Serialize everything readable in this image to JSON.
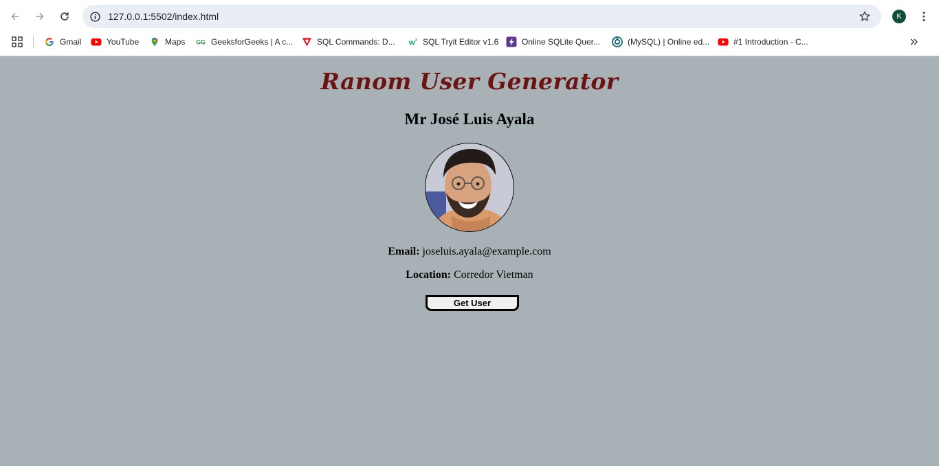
{
  "browser": {
    "url": "127.0.0.1:5502/index.html",
    "profile_initial": "K",
    "bookmarks": [
      {
        "label": "Gmail",
        "icon": "google-icon"
      },
      {
        "label": "YouTube",
        "icon": "youtube-icon"
      },
      {
        "label": "Maps",
        "icon": "maps-icon"
      },
      {
        "label": "GeeksforGeeks | A c...",
        "icon": "geeksforgeeks-icon"
      },
      {
        "label": "SQL Commands: D...",
        "icon": "sql-commands-icon"
      },
      {
        "label": "SQL Tryit Editor v1.6",
        "icon": "w3schools-icon"
      },
      {
        "label": "Online SQLite Quer...",
        "icon": "sqlite-icon"
      },
      {
        "label": "(MySQL) | Online ed...",
        "icon": "onecompiler-icon"
      },
      {
        "label": "#1 Introduction - C...",
        "icon": "youtube-icon"
      }
    ]
  },
  "page": {
    "title": "Ranom User Generator",
    "user_name": "Mr José Luis Ayala",
    "email_label": "Email:",
    "email": "joseluis.ayala@example.com",
    "location_label": "Location:",
    "location": "Corredor Vietman",
    "button_label": "Get User"
  },
  "colors": {
    "page_background": "#a8b2b6",
    "title_color": "#6b1412"
  }
}
